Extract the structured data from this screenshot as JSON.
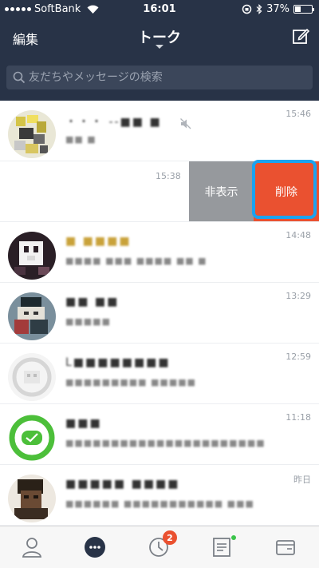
{
  "status": {
    "carrier": "SoftBank",
    "time": "16:01",
    "battery": "37%",
    "battery_level": 0.37
  },
  "nav": {
    "edit_label": "編集",
    "title": "トーク"
  },
  "search": {
    "placeholder": "友だちやメッセージの検索"
  },
  "chats": [
    {
      "name": "・・・ ‐‐■■ ■",
      "preview": "■■ ■",
      "time": "15:46",
      "muted": true
    },
    {
      "time": "15:38",
      "swiped": true
    },
    {
      "name": "■ ■■■■",
      "preview": "■■■■ ■■■ ■■■■ ■■ ■",
      "time": "14:48"
    },
    {
      "name": "■■ ■■",
      "preview": "■■■■■",
      "time": "13:29"
    },
    {
      "name": "L■■■■■■■■",
      "preview": "■■■■■■■■■ ■■■■■",
      "time": "12:59"
    },
    {
      "name": "■■■",
      "preview": "■■■■■■■■■■■■■■■■■■■■■■",
      "time": "11:18"
    },
    {
      "name": "■■■■■ ■■■■",
      "preview": "■■■■■■ ■■■■■■■■■■■ ■■■",
      "time": "昨日"
    }
  ],
  "swipe_actions": {
    "hide_label": "非表示",
    "delete_label": "削除"
  },
  "tabbar": {
    "timeline_badge": "2"
  },
  "colors": {
    "header_bg": "#283347",
    "delete": "#ea5130",
    "hide": "#96999d",
    "highlight": "#1aa3f0"
  }
}
